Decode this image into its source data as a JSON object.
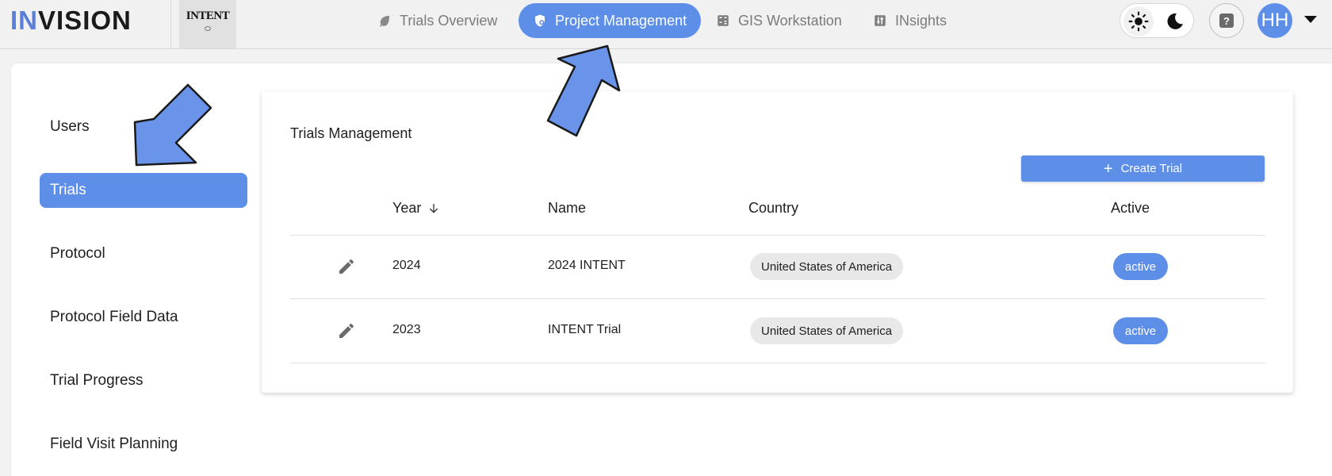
{
  "header": {
    "logo_accent": "IN",
    "logo_rest": "VISION",
    "brand_tile_text": "INTENT",
    "nav": [
      {
        "label": "Trials Overview",
        "icon": "leaf-icon"
      },
      {
        "label": "Project Management",
        "icon": "shield-gear-icon",
        "active": true
      },
      {
        "label": "GIS Workstation",
        "icon": "calculator-icon"
      },
      {
        "label": "INsights",
        "icon": "sliders-icon"
      }
    ],
    "help_label": "?",
    "avatar_initials": "HH"
  },
  "sidebar": {
    "items": [
      {
        "label": "Users"
      },
      {
        "label": "Trials",
        "active": true
      },
      {
        "label": "Protocol"
      },
      {
        "label": "Protocol Field Data"
      },
      {
        "label": "Trial Progress"
      },
      {
        "label": "Field Visit Planning"
      }
    ]
  },
  "panel": {
    "title": "Trials Management",
    "create_label": "Create Trial",
    "columns": {
      "year": "Year",
      "name": "Name",
      "country": "Country",
      "active": "Active"
    },
    "rows": [
      {
        "year": "2024",
        "name": "2024 INTENT",
        "country": "United States of America",
        "active": "active"
      },
      {
        "year": "2023",
        "name": "INTENT Trial",
        "country": "United States of America",
        "active": "active"
      }
    ]
  },
  "colors": {
    "accent": "#5e8fe8",
    "annotation_arrow": "#6a93ea"
  }
}
